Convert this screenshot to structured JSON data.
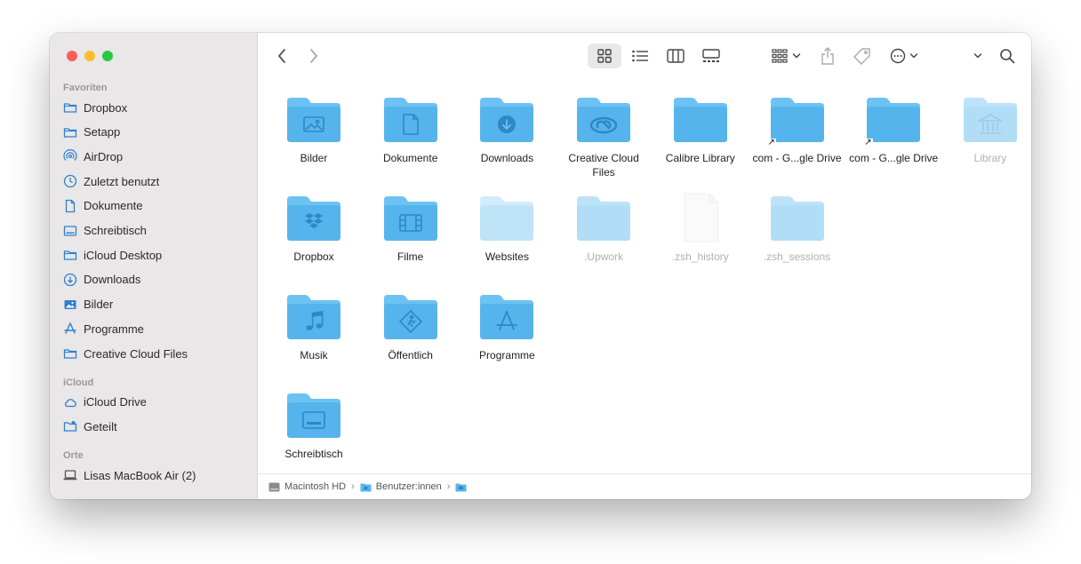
{
  "sidebar": {
    "favorites_label": "Favoriten",
    "favorites": [
      {
        "label": "Dropbox",
        "icon": "folder-icon"
      },
      {
        "label": "Setapp",
        "icon": "folder-icon"
      },
      {
        "label": "AirDrop",
        "icon": "airdrop-icon"
      },
      {
        "label": "Zuletzt benutzt",
        "icon": "clock-icon"
      },
      {
        "label": "Dokumente",
        "icon": "document-icon"
      },
      {
        "label": "Schreibtisch",
        "icon": "desktop-icon"
      },
      {
        "label": "iCloud Desktop",
        "icon": "folder-icon"
      },
      {
        "label": "Downloads",
        "icon": "download-icon"
      },
      {
        "label": "Bilder",
        "icon": "photo-icon"
      },
      {
        "label": "Programme",
        "icon": "apps-icon"
      },
      {
        "label": "Creative Cloud Files",
        "icon": "folder-icon"
      }
    ],
    "icloud_label": "iCloud",
    "icloud": [
      {
        "label": "iCloud Drive",
        "icon": "cloud-icon"
      },
      {
        "label": "Geteilt",
        "icon": "shared-folder-icon"
      }
    ],
    "locations_label": "Orte",
    "locations": [
      {
        "label": "Lisas MacBook Air (2)",
        "icon": "laptop-icon"
      }
    ]
  },
  "toolbar": {
    "active_view": "icon-view",
    "icons": [
      "back-icon",
      "forward-icon",
      "icon-view-icon",
      "list-view-icon",
      "column-view-icon",
      "gallery-view-icon",
      "group-icon",
      "share-icon",
      "tag-icon",
      "more-icon",
      "chevron-down-icon",
      "search-icon"
    ]
  },
  "files": [
    {
      "label": "Bilder",
      "glyph": "photo",
      "dim": false
    },
    {
      "label": "Dokumente",
      "glyph": "document",
      "dim": false
    },
    {
      "label": "Downloads",
      "glyph": "download",
      "dim": false
    },
    {
      "label": "Creative Cloud Files",
      "glyph": "creative-cloud",
      "dim": false
    },
    {
      "label": "Calibre Library",
      "glyph": "none",
      "dim": false
    },
    {
      "label": "com - G...gle Drive",
      "glyph": "none",
      "dim": false,
      "alias": true
    },
    {
      "label": "com - G...gle Drive",
      "glyph": "none",
      "dim": false,
      "alias": true
    },
    {
      "label": "Library",
      "glyph": "library",
      "dim": true
    },
    {
      "label": "Dropbox",
      "glyph": "dropbox",
      "dim": false
    },
    {
      "label": "Filme",
      "glyph": "film",
      "dim": false
    },
    {
      "label": "Websites",
      "glyph": "none",
      "dim": false,
      "pale": true
    },
    {
      "label": ".Upwork",
      "glyph": "none",
      "dim": true
    },
    {
      "label": ".zsh_history",
      "glyph": "file",
      "dim": true
    },
    {
      "label": ".zsh_sessions",
      "glyph": "none",
      "dim": true
    },
    {
      "label": "Musik",
      "glyph": "music",
      "dim": false
    },
    {
      "label": "Öffentlich",
      "glyph": "public",
      "dim": false
    },
    {
      "label": "Programme",
      "glyph": "apps",
      "dim": false
    },
    {
      "label": "Schreibtisch",
      "glyph": "desktop",
      "dim": false
    }
  ],
  "pathbar": {
    "segments": [
      "Macintosh HD",
      "Benutzer:innen",
      ""
    ]
  },
  "colors": {
    "folder": "#56b4ec",
    "folder_tab": "#6cc2f3",
    "glyph": "#2f86c8"
  }
}
